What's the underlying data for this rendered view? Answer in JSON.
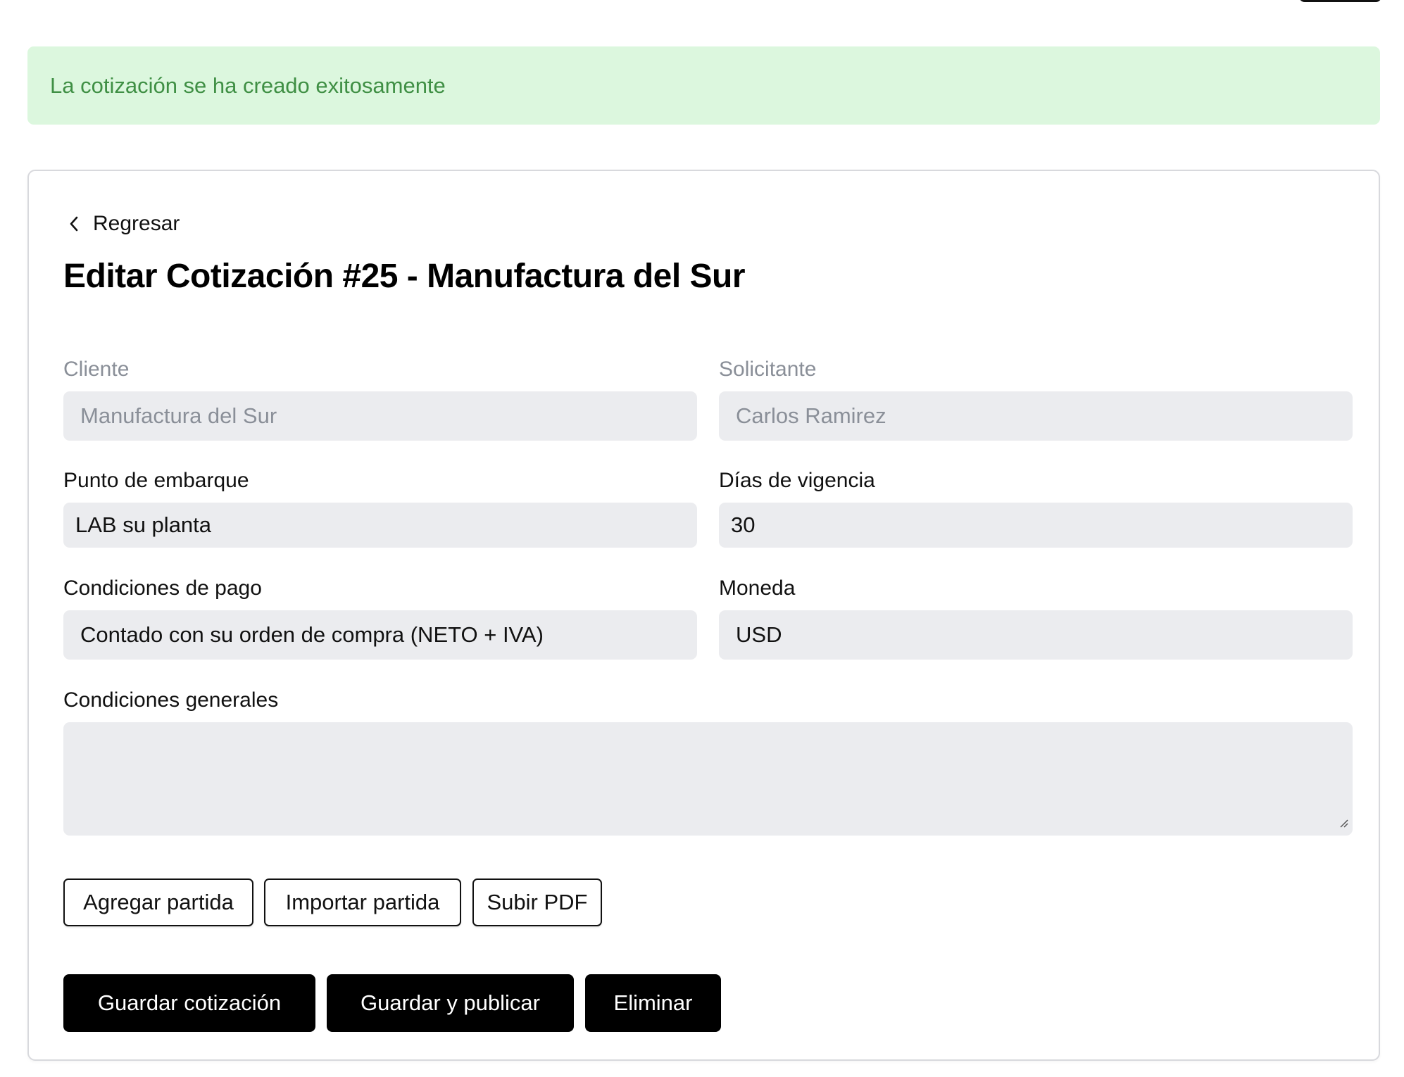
{
  "alert": {
    "message": "La cotización se ha creado exitosamente"
  },
  "back": {
    "label": "Regresar",
    "icon": "chevron-left-icon"
  },
  "form": {
    "title": "Editar Cotización #25 - Manufactura del Sur",
    "fields": {
      "cliente": {
        "label": "Cliente",
        "value": "Manufactura del Sur",
        "disabled": true
      },
      "solicitante": {
        "label": "Solicitante",
        "value": "Carlos Ramirez",
        "disabled": true
      },
      "punto_embarque": {
        "label": "Punto de embarque",
        "value": "LAB su planta"
      },
      "dias_vigencia": {
        "label": "Días de vigencia",
        "value": "30"
      },
      "condiciones_pago": {
        "label": "Condiciones de pago",
        "value": "Contado con su orden de compra (NETO + IVA)"
      },
      "moneda": {
        "label": "Moneda",
        "value": "USD"
      },
      "condiciones_generales": {
        "label": "Condiciones generales",
        "value": ""
      }
    }
  },
  "actions": {
    "agregar_partida": "Agregar partida",
    "importar_partida": "Importar partida",
    "subir_pdf": "Subir PDF",
    "guardar": "Guardar cotización",
    "guardar_publicar": "Guardar y publicar",
    "eliminar": "Eliminar"
  },
  "colors": {
    "alert_background": "#dcf7de",
    "alert_text": "#3f8f44",
    "field_background": "#ebecef",
    "primary_button": "#000000"
  }
}
